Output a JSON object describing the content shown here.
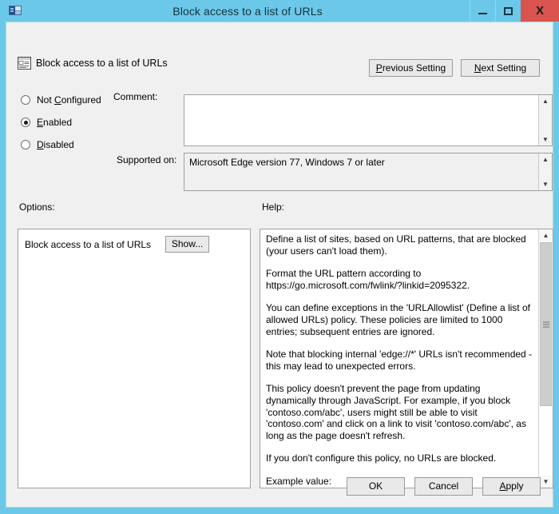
{
  "window": {
    "title": "Block access to a list of URLs",
    "icon": "gpedit-policy-icon",
    "controls": {
      "minimize": "minimize-icon",
      "maximize": "maximize-icon",
      "close": "X"
    },
    "accent_color": "#6cc8e8",
    "close_color": "#d9534f"
  },
  "header": {
    "icon": "policy-setting-icon",
    "title": "Block access to a list of URLs",
    "previous_setting": "Previous Setting",
    "previous_accesskey": "P",
    "next_setting": "Next Setting",
    "next_accesskey": "N"
  },
  "state": {
    "options": [
      {
        "label": "Not Configured",
        "accesskey": "C",
        "selected": false
      },
      {
        "label": "Enabled",
        "accesskey": "E",
        "selected": true
      },
      {
        "label": "Disabled",
        "accesskey": "D",
        "selected": false
      }
    ]
  },
  "comment": {
    "label": "Comment:",
    "value": "",
    "scroll_up": "▲",
    "scroll_down": "▼"
  },
  "supported": {
    "label": "Supported on:",
    "value": "Microsoft Edge version 77, Windows 7 or later",
    "scroll_up": "▲",
    "scroll_down": "▼"
  },
  "options_panel": {
    "label": "Options:",
    "row_label": "Block access to a list of URLs",
    "show_button": "Show..."
  },
  "help_panel": {
    "label": "Help:",
    "scroll_up": "▲",
    "scroll_down": "▼",
    "paragraphs": [
      "Define a list of sites, based on URL patterns, that are blocked (your users can't load them).",
      "Format the URL pattern according to https://go.microsoft.com/fwlink/?linkid=2095322.",
      "You can define exceptions in the 'URLAllowlist' (Define a list of allowed URLs) policy. These policies are limited to 1000 entries; subsequent entries are ignored.",
      "Note that blocking internal 'edge://*' URLs isn't recommended - this may lead to unexpected errors.",
      "This policy doesn't prevent the page from updating dynamically through JavaScript. For example, if you block 'contoso.com/abc', users might still be able to visit 'contoso.com' and click on a link to visit 'contoso.com/abc', as long as the page doesn't refresh.",
      "If you don't configure this policy, no URLs are blocked.",
      "Example value:"
    ]
  },
  "footer": {
    "ok": "OK",
    "cancel": "Cancel",
    "apply": "Apply",
    "apply_accesskey": "A"
  }
}
